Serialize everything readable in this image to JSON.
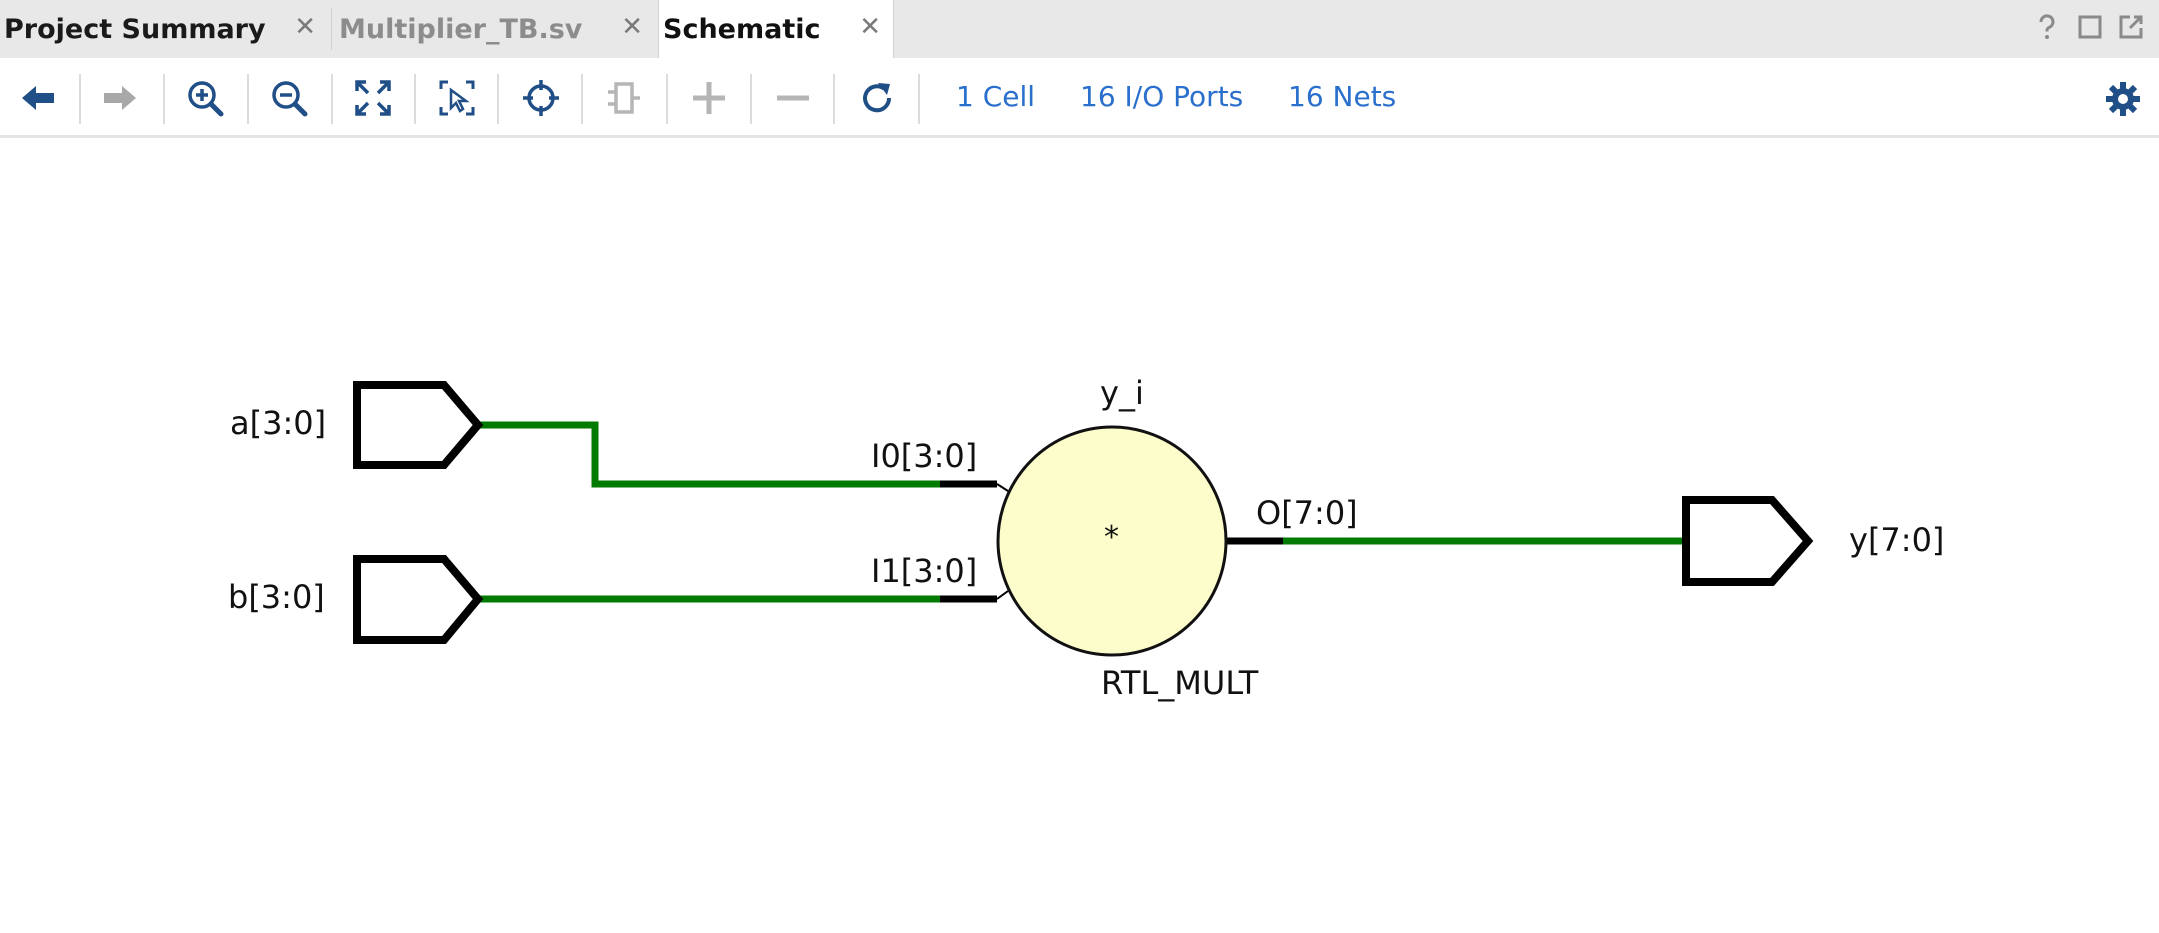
{
  "tabs": [
    {
      "label": "Project Summary",
      "close": "✕"
    },
    {
      "label": "Multiplier_TB.sv",
      "close": "✕"
    },
    {
      "label": "Schematic",
      "close": "✕"
    }
  ],
  "window_controls": [
    "help-icon",
    "maximize-icon",
    "float-icon"
  ],
  "toolbar": {
    "icons": [
      "back-arrow-icon",
      "forward-arrow-icon",
      "zoom-in-icon",
      "zoom-out-icon",
      "fit-view-icon",
      "zoom-selection-icon",
      "autofit-selection-icon",
      "collapse-cell-icon",
      "expand-icon",
      "contract-icon",
      "refresh-icon",
      "settings-gear-icon"
    ],
    "stats": {
      "cells": "1 Cell",
      "ports": "16 I/O Ports",
      "nets": "16 Nets"
    }
  },
  "schematic": {
    "inputs": [
      {
        "name": "a[3:0]"
      },
      {
        "name": "b[3:0]"
      }
    ],
    "outputs": [
      {
        "name": "y[7:0]"
      }
    ],
    "cell": {
      "instance": "y_i",
      "type": "RTL_MULT",
      "symbol": "*",
      "pins": {
        "in0": "I0[3:0]",
        "in1": "I1[3:0]",
        "out": "O[7:0]"
      }
    },
    "colors": {
      "net": "#007a00",
      "pin": "#000000",
      "cell_fill": "#fdfdcc",
      "port_stroke": "#000000"
    }
  }
}
